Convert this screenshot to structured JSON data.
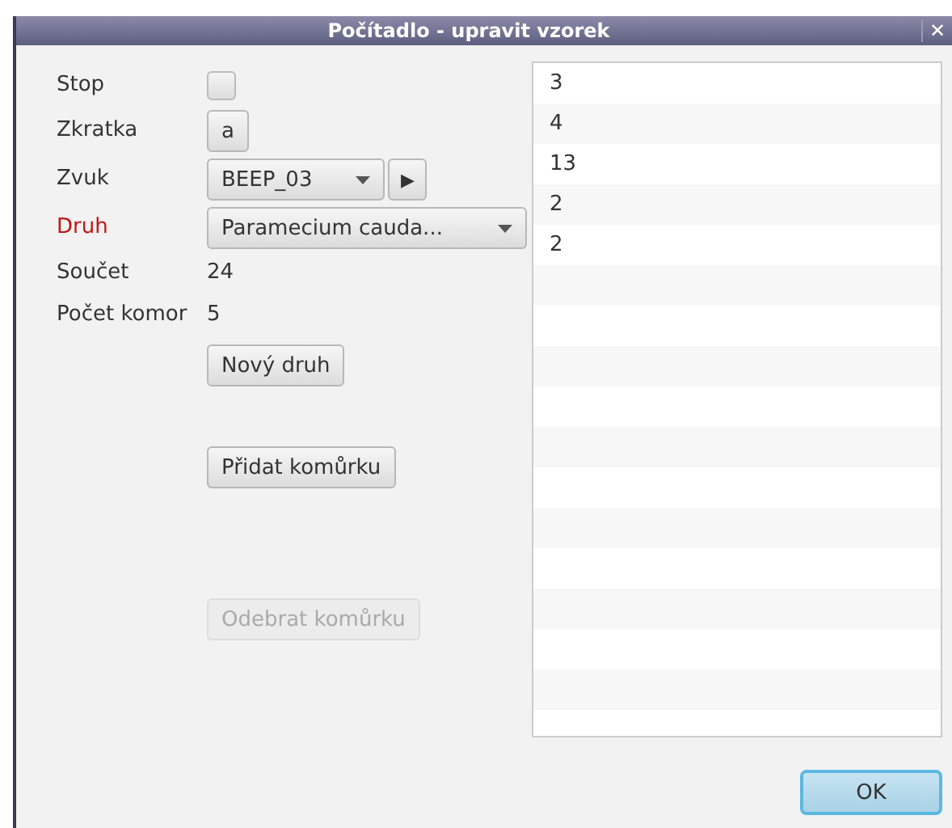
{
  "window": {
    "title": "Počítadlo - upravit vzorek",
    "close": "✕"
  },
  "form": [
    {
      "kind": "checkbox",
      "label": "Stop",
      "required": false,
      "checked": false
    },
    {
      "kind": "keybutton",
      "label": "Zkratka",
      "required": false,
      "value": "a"
    },
    {
      "kind": "sound",
      "label": "Zvuk",
      "required": false,
      "value": "BEEP_03",
      "play": "▶"
    },
    {
      "kind": "combo",
      "label": "Druh",
      "required": true,
      "value": "Paramecium cauda..."
    },
    {
      "kind": "text",
      "label": "Součet",
      "required": false,
      "value": "24"
    },
    {
      "kind": "text",
      "label": "Počet komor",
      "required": false,
      "value": "5"
    }
  ],
  "buttons": [
    {
      "label": "Nový druh",
      "disabled": false
    },
    {
      "label": "Přidat komůrku",
      "disabled": false
    },
    {
      "label": "Odebrat komůrku",
      "disabled": true
    }
  ],
  "list": [
    "3",
    "4",
    "13",
    "2",
    "2"
  ],
  "ok": "OK"
}
